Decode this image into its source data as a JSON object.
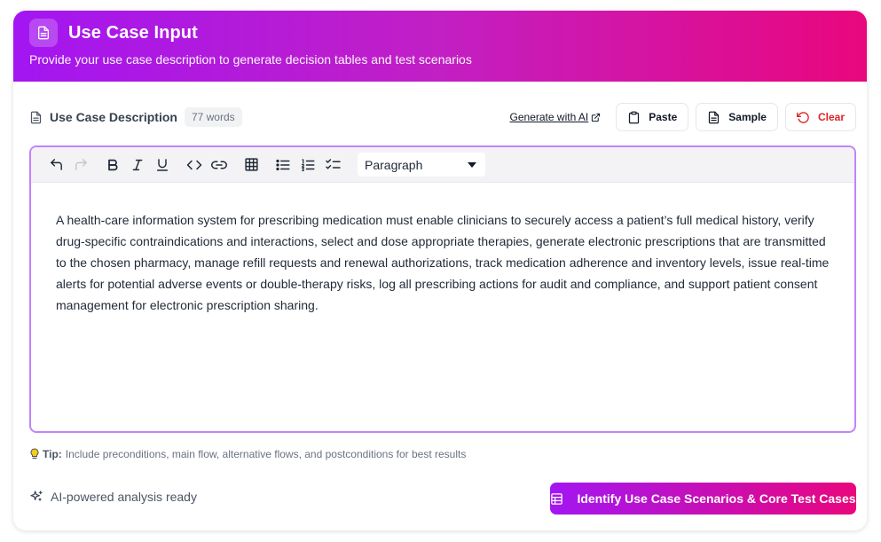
{
  "header": {
    "title": "Use Case Input",
    "subtitle": "Provide your use case description to generate decision tables and test scenarios"
  },
  "section": {
    "label": "Use Case Description",
    "word_count": "77 words"
  },
  "actions": {
    "generate_ai": "Generate with AI",
    "paste": "Paste",
    "sample": "Sample",
    "clear": "Clear"
  },
  "editor": {
    "block_type": "Paragraph",
    "content": "A health-care information system for prescribing medication must enable clinicians to securely access a patient’s full medical history, verify drug-specific contraindications and interactions, select and dose appropriate therapies, generate electronic prescriptions that are transmitted to the chosen pharmacy, manage refill requests and renewal authorizations, track medication adherence and inventory levels, issue real-time alerts for potential adverse events or double-therapy risks, log all prescribing actions for audit and compliance, and support patient consent management for electronic prescription sharing."
  },
  "tip": {
    "label": "Tip:",
    "text": "Include preconditions, main flow, alternative flows, and postconditions for best results"
  },
  "footer": {
    "status": "AI-powered analysis ready",
    "cta": "Identify Use Case Scenarios & Core Test Cases"
  },
  "colors": {
    "gradient_start": "#a316f2",
    "gradient_end": "#e9077d",
    "editor_border": "#c084fc",
    "clear_red": "#dc2626"
  }
}
